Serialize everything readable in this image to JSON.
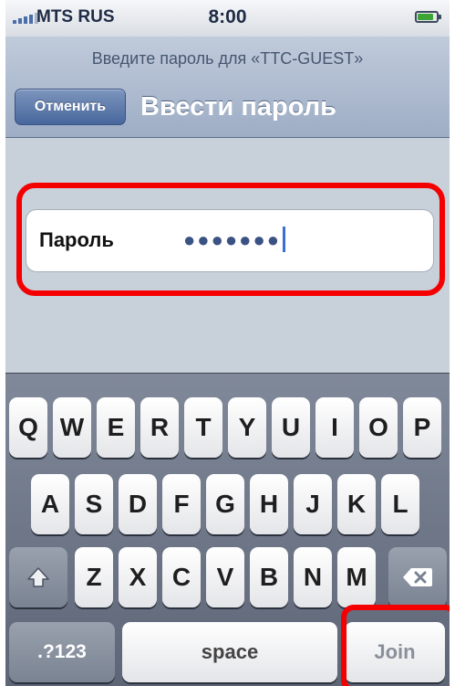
{
  "status_bar": {
    "carrier": "MTS RUS",
    "time": "8:00",
    "signal_icon": "signal-bars-icon",
    "battery_icon": "battery-icon",
    "battery_level": 0.85
  },
  "nav": {
    "prompt": "Введите пароль для «TTC-GUEST»",
    "cancel_label": "Отменить",
    "title": "Ввести пароль"
  },
  "password_field": {
    "label": "Пароль",
    "value": "●●●●●●●"
  },
  "keyboard": {
    "row1": [
      "Q",
      "W",
      "E",
      "R",
      "T",
      "Y",
      "U",
      "I",
      "O",
      "P"
    ],
    "row2": [
      "A",
      "S",
      "D",
      "F",
      "G",
      "H",
      "J",
      "K",
      "L"
    ],
    "row3": [
      "Z",
      "X",
      "C",
      "V",
      "B",
      "N",
      "M"
    ],
    "shift_icon": "shift-arrow-icon",
    "delete_icon": "backspace-icon",
    "mode_label": ".?123",
    "space_label": "space",
    "join_label": "Join"
  },
  "colors": {
    "highlight": "#f40000",
    "nav_bar": "#a9b6cb",
    "cancel_button": "#5874a8",
    "caret": "#3a6fd8"
  }
}
